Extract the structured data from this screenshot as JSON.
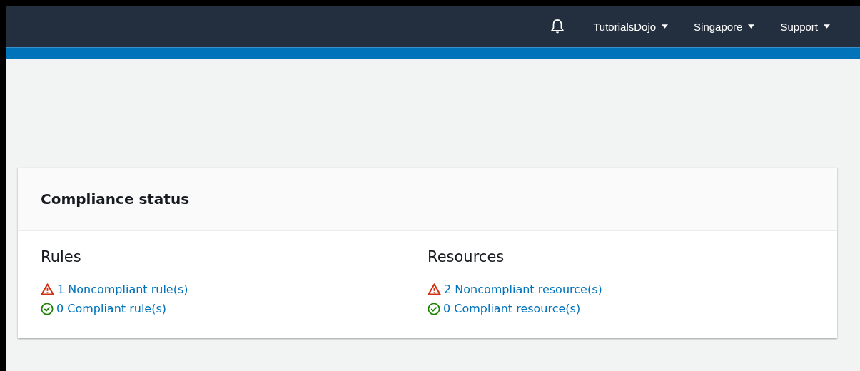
{
  "top_nav": {
    "items": [
      {
        "label": "TutorialsDojo"
      },
      {
        "label": "Singapore"
      },
      {
        "label": "Support"
      }
    ]
  },
  "compliance_status": {
    "title": "Compliance status",
    "sections": [
      {
        "heading": "Rules",
        "links": [
          {
            "kind": "noncompliant",
            "label": "1 Noncompliant rule(s)"
          },
          {
            "kind": "compliant",
            "label": "0 Compliant rule(s)"
          }
        ]
      },
      {
        "heading": "Resources",
        "links": [
          {
            "kind": "noncompliant",
            "label": "2 Noncompliant resource(s)"
          },
          {
            "kind": "compliant",
            "label": "0 Compliant resource(s)"
          }
        ]
      }
    ]
  }
}
